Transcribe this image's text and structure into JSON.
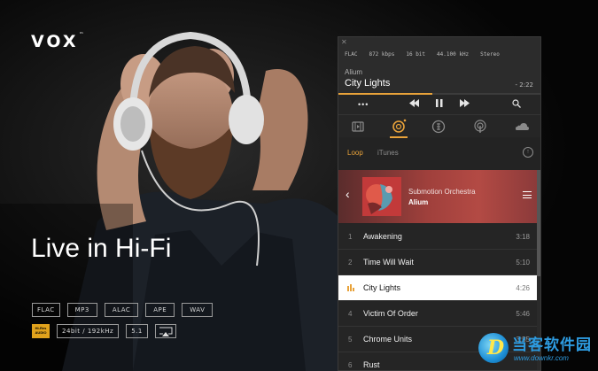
{
  "hero": {
    "logo": "VOX",
    "logo_tm": "™",
    "tagline": "Live in Hi-Fi",
    "formats_row1": [
      "FLAC",
      "MP3",
      "ALAC",
      "APE",
      "WAV"
    ],
    "formats_row2": [
      "24bit / 192kHz",
      "5.1"
    ],
    "hires_badge": "Hi-Res AUDIO",
    "airplay_icon": "airplay-icon"
  },
  "player": {
    "close": "✕",
    "meta": [
      "FLAC",
      "872 kbps",
      "16 bit",
      "44.100 kHz",
      "Stereo"
    ],
    "now_playing": {
      "album": "Alium",
      "title": "City Lights",
      "time": "- 2:22",
      "progress": 0.46
    },
    "controls": {
      "more": "•••",
      "prev": "⏮",
      "pause": "⏸",
      "next": "⏭",
      "search_icon": "search-icon"
    },
    "sources": [
      "playlist-icon",
      "loop-icon",
      "itunes-icon",
      "radio-icon",
      "soundcloud-icon"
    ],
    "tabs": {
      "active": "Loop",
      "other": "iTunes"
    },
    "upload_icon": "arrow-up-icon",
    "album_header": {
      "back": "‹",
      "artist": "Submotion Orchestra",
      "album": "Alium"
    },
    "tracks": [
      {
        "num": "1",
        "name": "Awakening",
        "duration": "3:18",
        "playing": false
      },
      {
        "num": "2",
        "name": "Time Will Wait",
        "duration": "5:10",
        "playing": false
      },
      {
        "num": "3",
        "name": "City Lights",
        "duration": "4:26",
        "playing": true
      },
      {
        "num": "4",
        "name": "Victim Of Order",
        "duration": "5:46",
        "playing": false
      },
      {
        "num": "5",
        "name": "Chrome Units",
        "duration": "3:55",
        "playing": false
      },
      {
        "num": "6",
        "name": "Rust",
        "duration": "",
        "playing": false
      }
    ]
  },
  "watermark": {
    "logo_letter": "D",
    "text": "当客软件园",
    "url": "www.downkr.com"
  },
  "colors": {
    "accent": "#e8a23a",
    "album_red": "#b34a44",
    "watermark_blue": "#2d9be0"
  }
}
